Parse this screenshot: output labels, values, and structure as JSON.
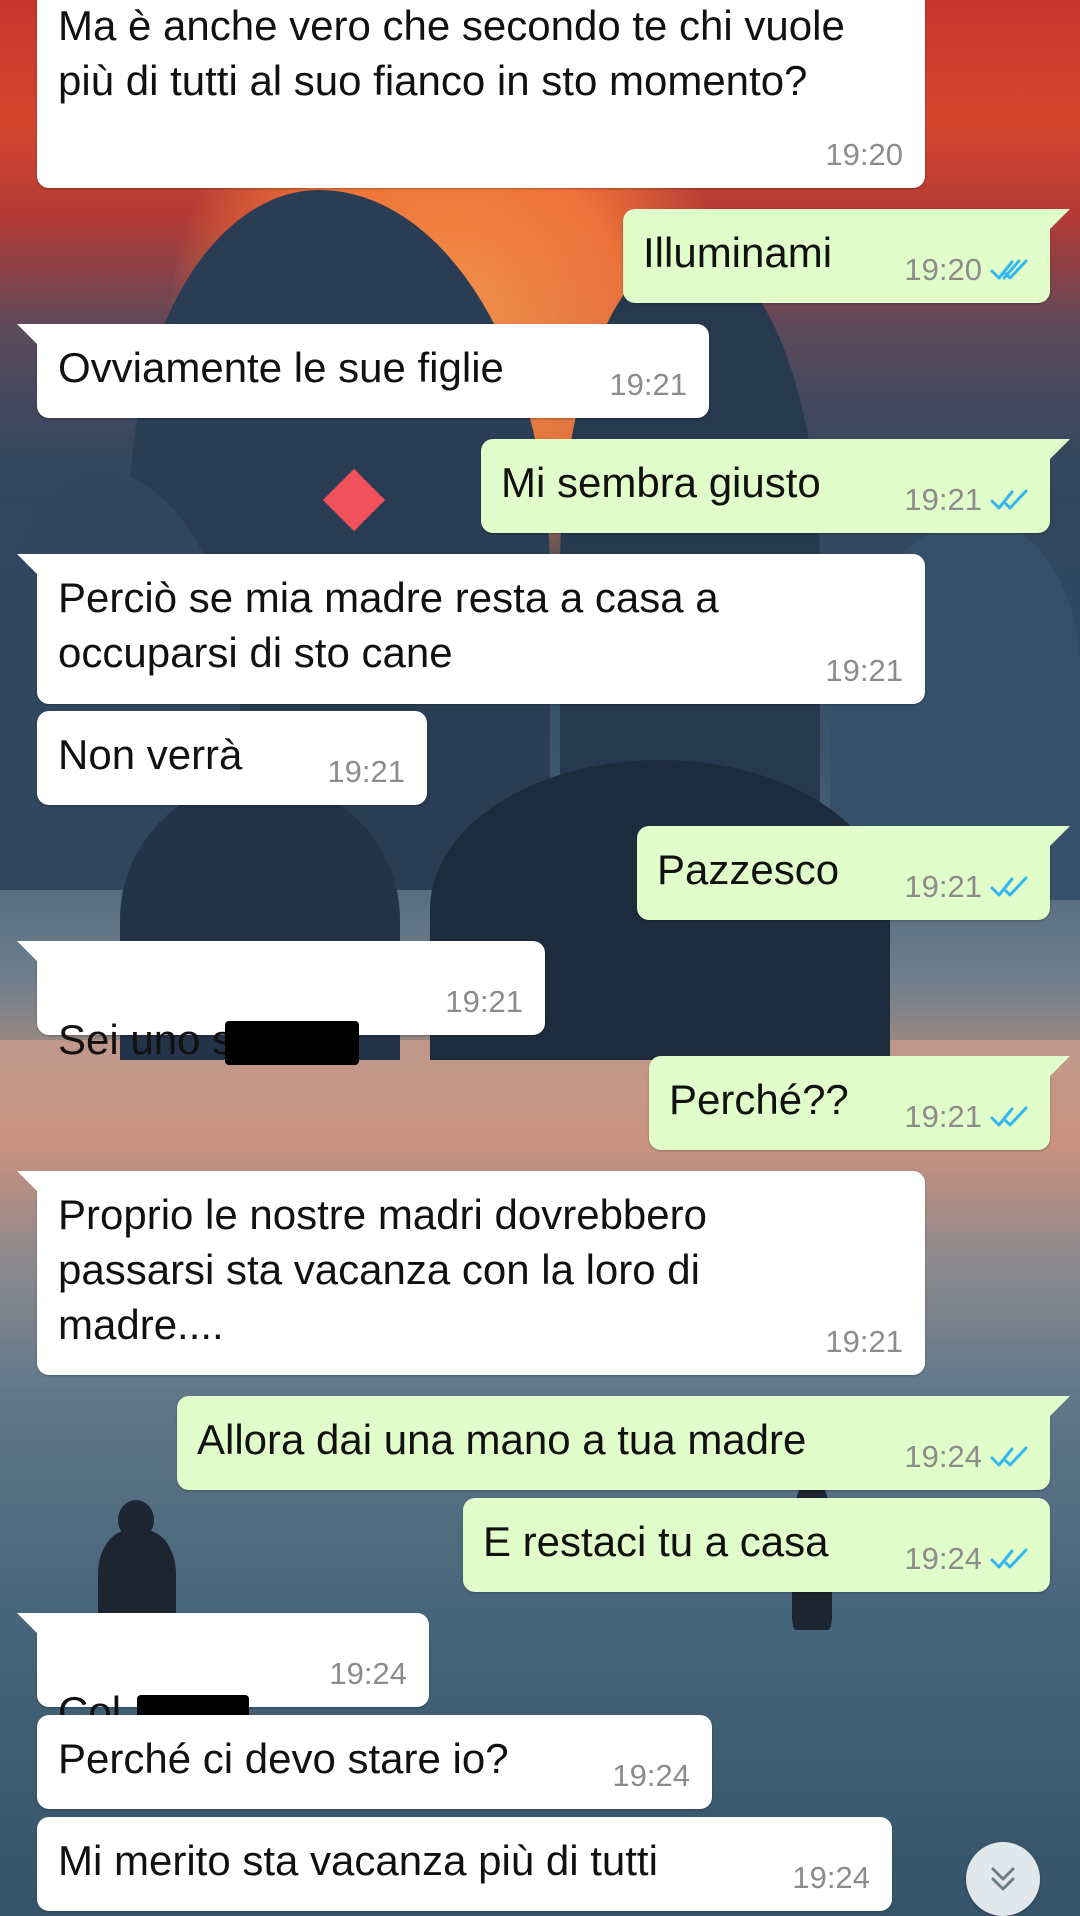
{
  "messages": [
    {
      "text": "Ma è anche vero che secondo te chi vuole\npiù di tutti al suo fianco in sto momento?",
      "time": "19:20"
    },
    {
      "text": "Illuminami",
      "time": "19:20"
    },
    {
      "text": "Ovviamente le sue figlie",
      "time": "19:21"
    },
    {
      "text": "Mi sembra giusto",
      "time": "19:21"
    },
    {
      "text": "Perciò se mia madre resta a casa a\noccuparsi di sto cane",
      "time": "19:21"
    },
    {
      "text": "Non verrà",
      "time": "19:21"
    },
    {
      "text": "Pazzesco",
      "time": "19:21"
    },
    {
      "text": "Sei uno s",
      "time": "19:21"
    },
    {
      "text": "Perché??",
      "time": "19:21"
    },
    {
      "text": "Proprio le nostre madri dovrebbero\npassarsi sta vacanza con la loro di\nmadre....",
      "time": "19:21"
    },
    {
      "text": "Allora dai una mano a tua madre",
      "time": "19:24"
    },
    {
      "text": "E restaci tu a casa",
      "time": "19:24"
    },
    {
      "text": "Col",
      "time": "19:24"
    },
    {
      "text": "Perché ci devo stare io?",
      "time": "19:24"
    },
    {
      "text": "Mi merito sta vacanza più di tutti",
      "time": "19:24"
    }
  ],
  "colors": {
    "incoming_bubble": "#ffffff",
    "outgoing_bubble": "#e1fdc9",
    "read_ticks": "#34b7f1",
    "timestamp": "#8c8c8c"
  },
  "icons": {
    "read_receipt": "double-check-icon",
    "scroll_down": "double-chevron-down-icon"
  }
}
